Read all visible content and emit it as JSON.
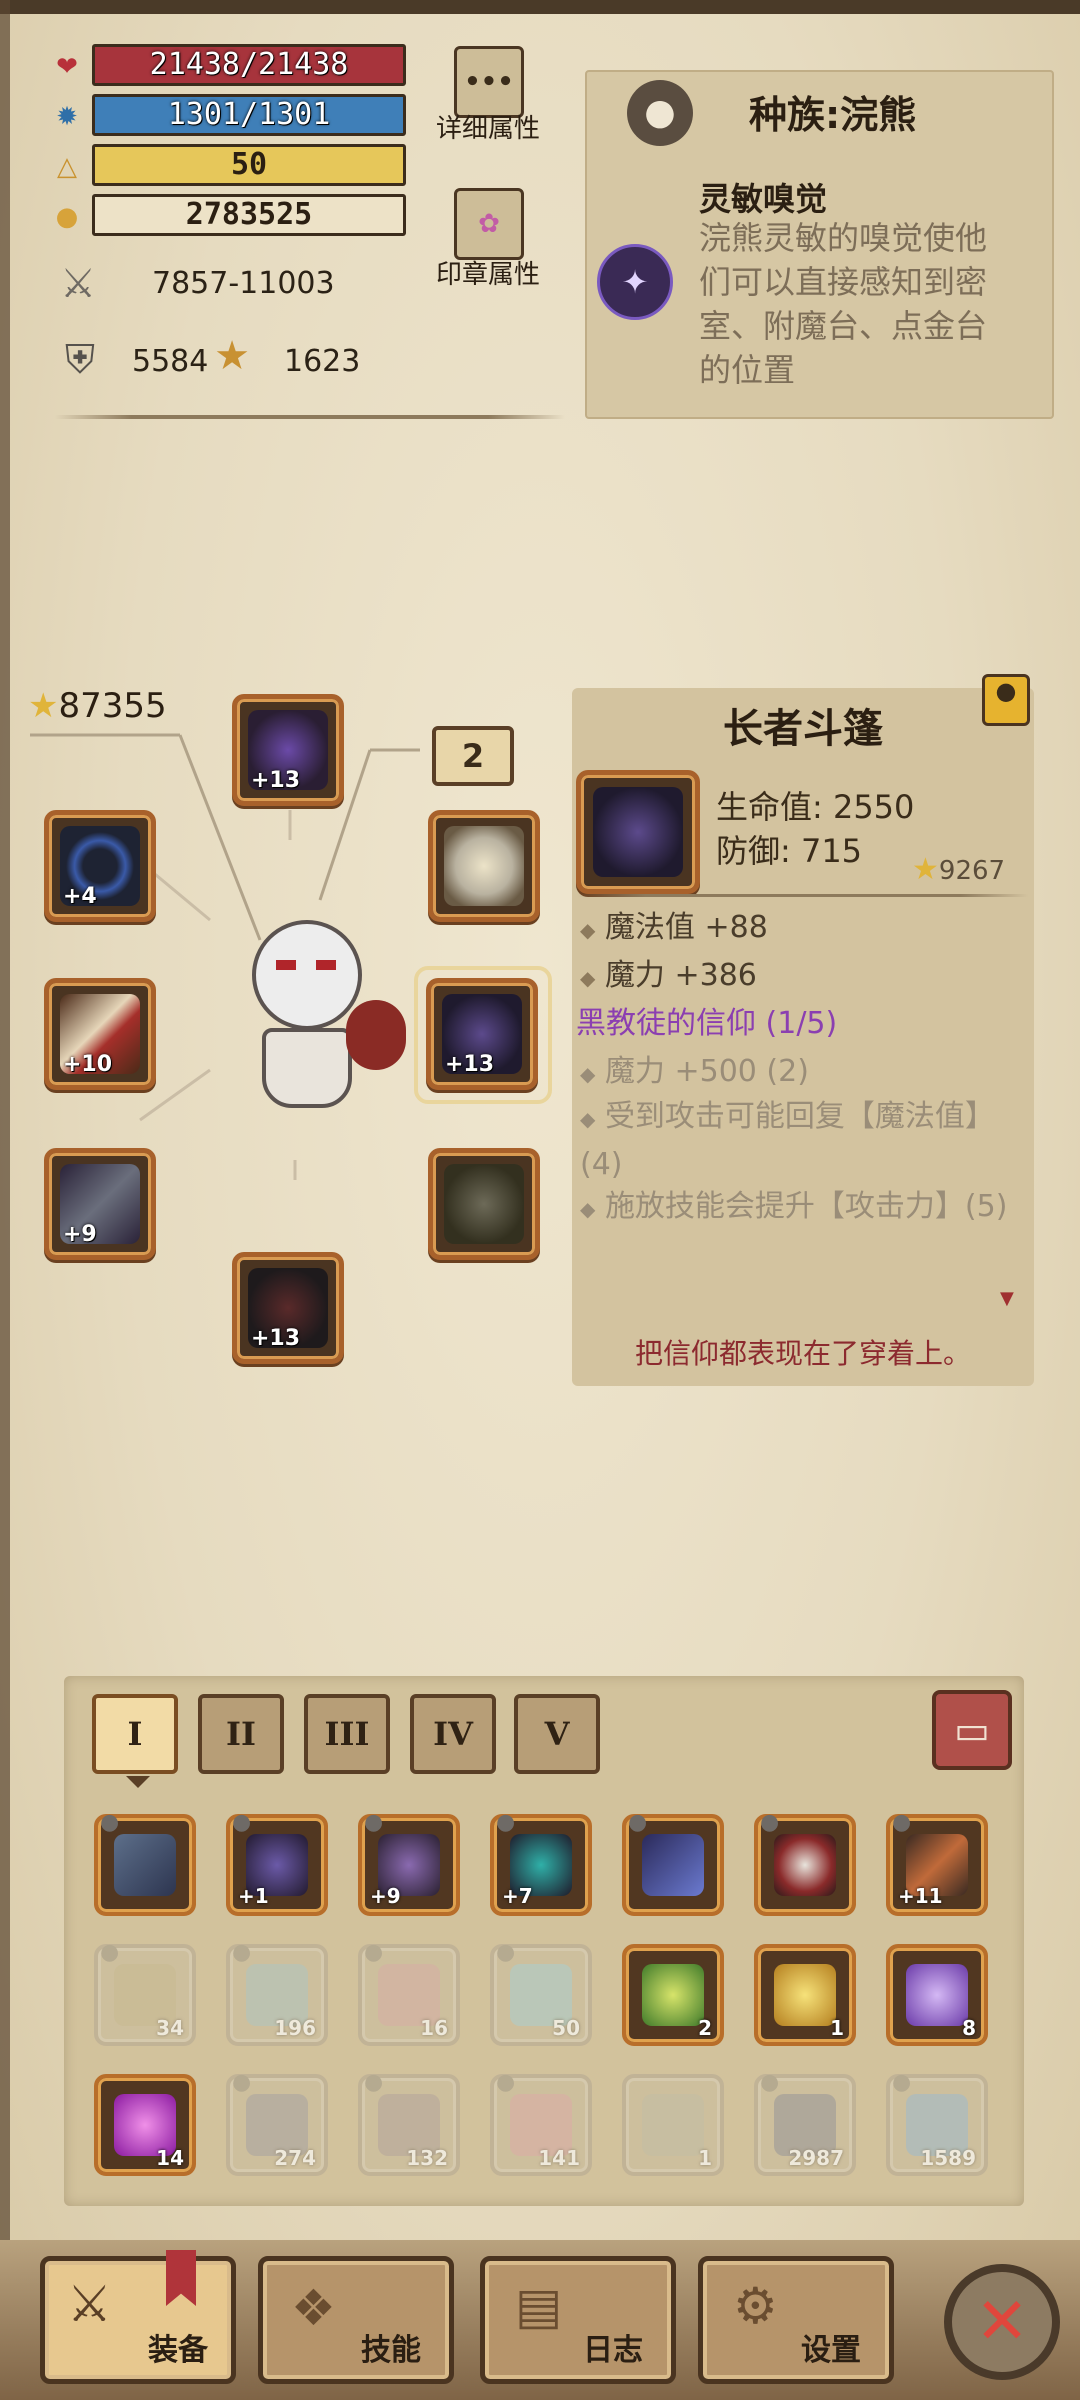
{
  "stats": {
    "hp": "21438/21438",
    "mp": "1301/1301",
    "level": "50",
    "gold": "2783525",
    "attack": "7857-11003",
    "defense": "5584",
    "luck": "1623"
  },
  "side_buttons": {
    "details_label": "详细属性",
    "seal_label": "印章属性"
  },
  "race": {
    "title": "种族:浣熊",
    "skill_name": "灵敏嗅觉",
    "skill_desc": "浣熊灵敏的嗅觉使他们可以直接感知到密室、附魔台、点金台的位置"
  },
  "character": {
    "score": "87355",
    "page_number": "2",
    "slots": {
      "helmet_plus": "+13",
      "ring_plus": "+4",
      "weapon_plus": "+10",
      "gauntlet_plus": "+9",
      "cloak_plus": "+13",
      "boots_plus": "+13"
    }
  },
  "item": {
    "name": "长者斗篷",
    "hp_line": "生命值: 2550",
    "def_line": "防御: 715",
    "score": "9267",
    "attrs": [
      "魔法值 +88",
      "魔力 +386"
    ],
    "set_name": "黑教徒的信仰 (1/5)",
    "set_bonus_1": "魔力 +500 (2)",
    "set_bonus_2": "受到攻击可能回复【魔法值】(4)",
    "set_bonus_3": "施放技能会提升【攻击力】(5)",
    "flavor": "把信仰都表现在了穿着上。"
  },
  "inventory": {
    "tabs": [
      "I",
      "II",
      "III",
      "IV",
      "V"
    ],
    "row1": [
      {
        "plus": ""
      },
      {
        "plus": "+1"
      },
      {
        "plus": "+9"
      },
      {
        "plus": "+7"
      },
      {
        "plus": ""
      },
      {
        "plus": ""
      },
      {
        "plus": "+11"
      }
    ],
    "row2": [
      "34",
      "196",
      "16",
      "50",
      "2",
      "1",
      "8"
    ],
    "row3": [
      "14",
      "274",
      "132",
      "141",
      "1",
      "2987",
      "1589"
    ]
  },
  "nav": {
    "equip": "装备",
    "skills": "技能",
    "log": "日志",
    "settings": "设置"
  }
}
